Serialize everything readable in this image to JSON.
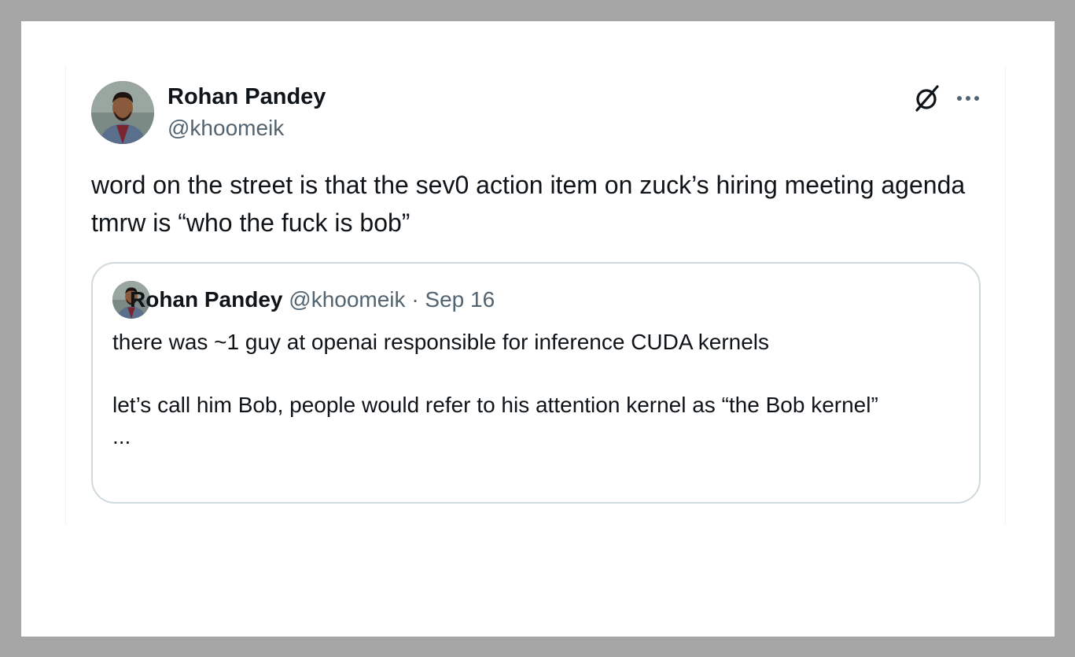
{
  "tweet": {
    "author_name": "Rohan Pandey",
    "author_handle": "@khoomeik",
    "text": "word on the street is that the sev0 action item on zuck’s hiring meeting agenda tmrw is “who the fuck is bob”",
    "icons": {
      "grok": "grok-icon",
      "more": "more-options-icon"
    }
  },
  "quote": {
    "author_name": "Rohan Pandey",
    "author_handle": "@khoomeik",
    "separator": "·",
    "date": "Sep 16",
    "text": "there was ~1 guy at openai responsible for inference CUDA kernels\n\nlet’s call him Bob, people would refer to his attention kernel as “the Bob kernel”\n..."
  },
  "colors": {
    "background": "#a6a6a6",
    "card": "#ffffff",
    "text_primary": "#0f1419",
    "text_secondary": "#536471",
    "border": "#cfd9de"
  }
}
